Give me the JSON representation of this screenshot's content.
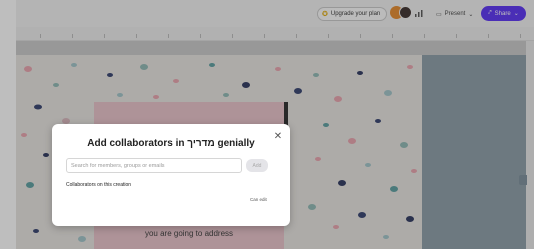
{
  "topbar": {
    "upgrade_label": "Upgrade your plan",
    "present_label": "Present",
    "share_label": "Share"
  },
  "slide": {
    "text": "you are going to address"
  },
  "modal": {
    "title": "Add collaborators in מדריך genially",
    "close_glyph": "✕",
    "search_placeholder": "Search for members, groups or emails",
    "add_label": "Add",
    "section_label": "Collaborators on this creation",
    "permission_label": "Can edit"
  },
  "colors": {
    "accent": "#5a31f4",
    "slide_background": "#e7e4e0",
    "card": "#e8c2c9",
    "side_panel": "#8c9ca6"
  },
  "icons": [
    "star-icon",
    "signal-icon",
    "present-icon",
    "chevron-down-icon",
    "share-icon",
    "close-icon"
  ]
}
